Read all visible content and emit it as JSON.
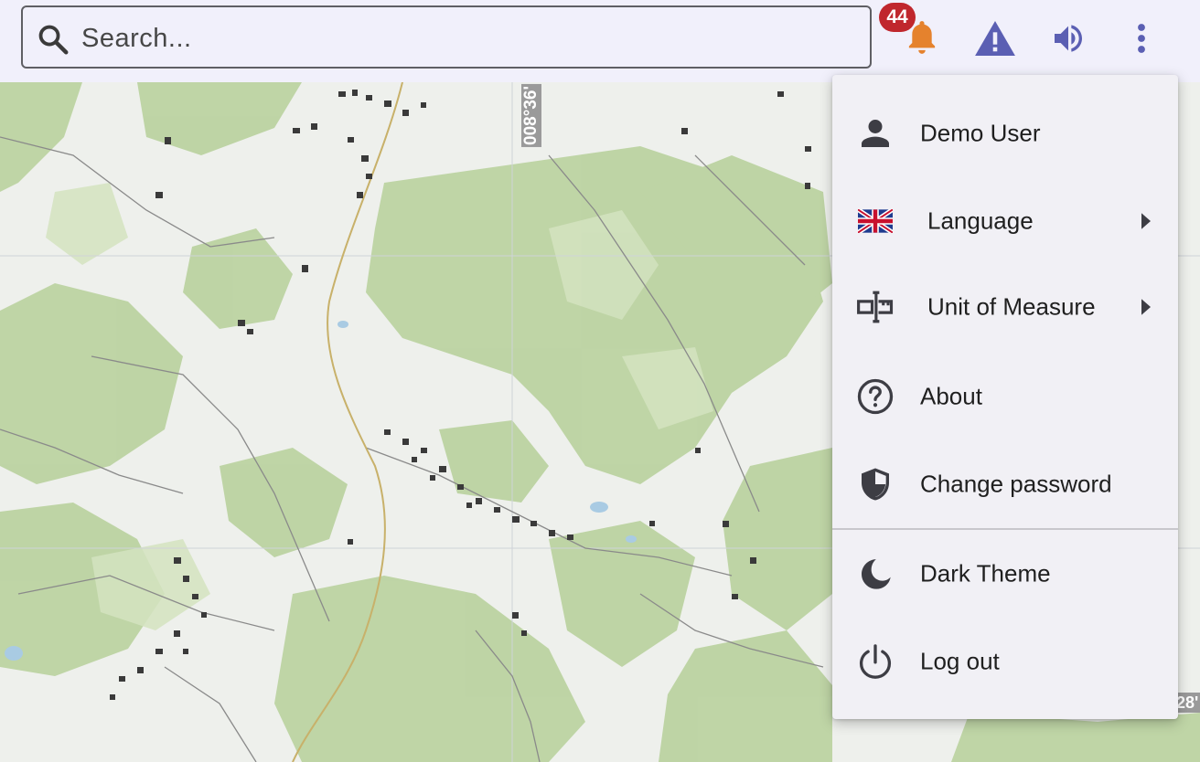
{
  "search": {
    "placeholder": "Search..."
  },
  "notifications": {
    "count": "44",
    "icon": "bell-icon"
  },
  "toolbar": {
    "icons": [
      "bell-icon",
      "warning-icon",
      "volume-icon",
      "more-vert-icon"
    ]
  },
  "map": {
    "coord_vertical": "008°36'",
    "coord_edge": "28'"
  },
  "menu": {
    "items": [
      {
        "label": "Demo User",
        "icon": "person-icon"
      },
      {
        "label": "Language",
        "icon": "uk-flag-icon",
        "submenu": true
      },
      {
        "label": "Unit of Measure",
        "icon": "ruler-icon",
        "submenu": true
      },
      {
        "label": "About",
        "icon": "help-circle-icon"
      },
      {
        "label": "Change password",
        "icon": "shield-icon"
      },
      {
        "label": "Dark Theme",
        "icon": "moon-icon"
      },
      {
        "label": "Log out",
        "icon": "power-icon"
      }
    ]
  },
  "colors": {
    "accent": "#5b5fb3",
    "bell": "#e5822d",
    "badge": "#c0272d",
    "topbar_bg": "#f1f0fb",
    "menu_bg": "#f1f0f5"
  }
}
